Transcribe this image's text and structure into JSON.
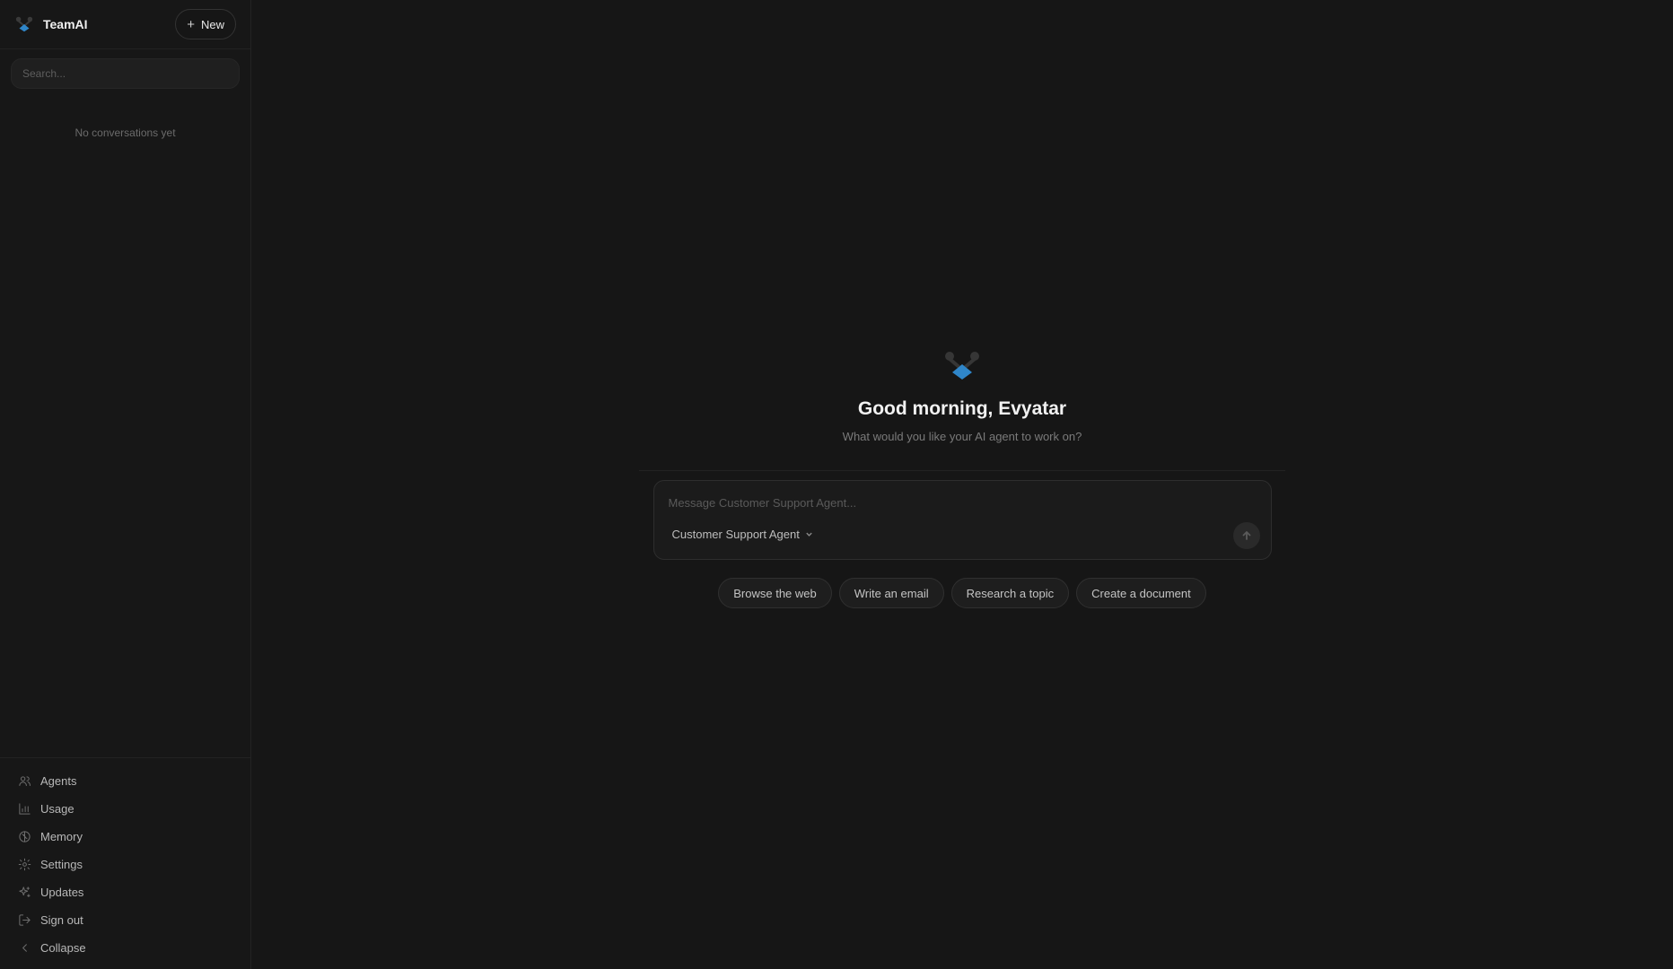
{
  "brand": {
    "name": "TeamAI"
  },
  "sidebar": {
    "new_label": "New",
    "search_placeholder": "Search...",
    "empty_text": "No conversations yet",
    "nav": [
      {
        "label": "Agents",
        "icon": "users-icon"
      },
      {
        "label": "Usage",
        "icon": "bar-chart-icon"
      },
      {
        "label": "Memory",
        "icon": "brain-icon"
      },
      {
        "label": "Settings",
        "icon": "gear-icon"
      },
      {
        "label": "Updates",
        "icon": "sparkles-icon"
      },
      {
        "label": "Sign out",
        "icon": "sign-out-icon"
      },
      {
        "label": "Collapse",
        "icon": "chevron-left-icon"
      }
    ]
  },
  "main": {
    "greeting": "Good morning, Evyatar",
    "subtitle": "What would you like your AI agent to work on?",
    "message_placeholder": "Message Customer Support Agent...",
    "selected_agent": "Customer Support Agent",
    "suggestions": [
      "Browse the web",
      "Write an email",
      "Research a topic",
      "Create a document"
    ]
  },
  "colors": {
    "background": "#161616",
    "sidebar": "#171717",
    "accent": "#2f86c9"
  }
}
